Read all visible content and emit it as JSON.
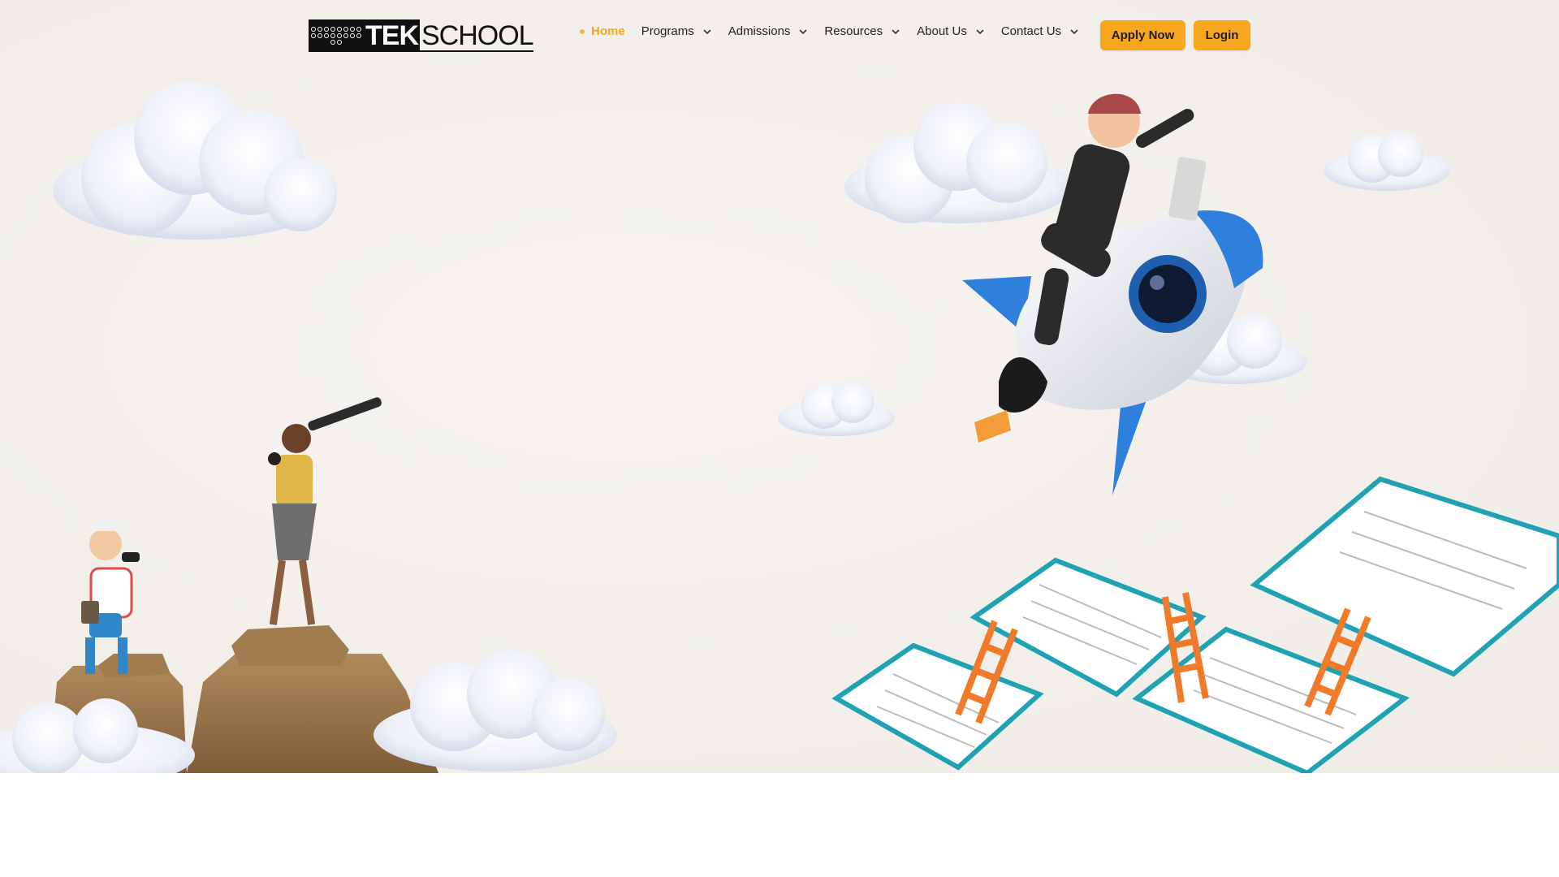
{
  "brand": {
    "logo_text_tek": "TEK",
    "logo_text_school": "SCHOOL"
  },
  "nav": {
    "items": [
      {
        "label": "Home",
        "active": true,
        "has_dropdown": false
      },
      {
        "label": "Programs",
        "active": false,
        "has_dropdown": true
      },
      {
        "label": "Admissions",
        "active": false,
        "has_dropdown": true
      },
      {
        "label": "Resources",
        "active": false,
        "has_dropdown": true
      },
      {
        "label": "About Us",
        "active": false,
        "has_dropdown": true
      },
      {
        "label": "Contact Us",
        "active": false,
        "has_dropdown": true
      }
    ]
  },
  "actions": {
    "apply_label": "Apply Now",
    "login_label": "Login"
  },
  "colors": {
    "accent": "#f8a61e",
    "active_nav": "#f5a623",
    "text": "#222222"
  },
  "hero": {
    "illustrations": [
      "cloud-icon",
      "explorer-figure-icon",
      "telescope-figure-icon",
      "rocket-rider-icon",
      "open-book-icon",
      "ladder-icon"
    ]
  }
}
